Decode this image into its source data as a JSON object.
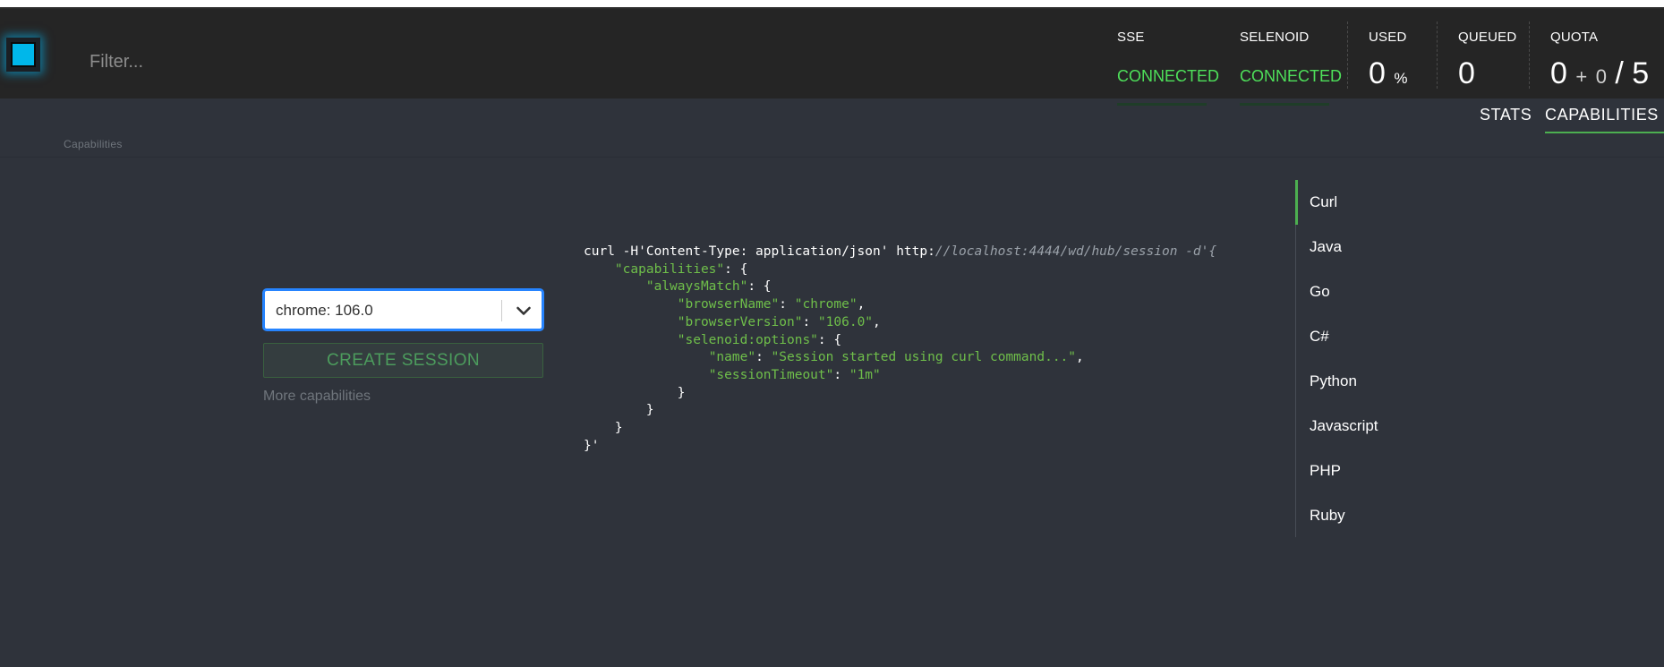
{
  "filter": {
    "placeholder": "Filter..."
  },
  "stats": {
    "sse": {
      "label": "SSE",
      "status": "CONNECTED"
    },
    "selenoid": {
      "label": "SELENOID",
      "status": "CONNECTED"
    },
    "used": {
      "label": "USED",
      "value": "0",
      "unit": "%"
    },
    "queued": {
      "label": "QUEUED",
      "value": "0"
    },
    "quota": {
      "label": "QUOTA",
      "current": "0",
      "plus": "+",
      "pending": "0",
      "separator": "/",
      "total": "5"
    }
  },
  "tabs": [
    {
      "label": "STATS",
      "active": false
    },
    {
      "label": "CAPABILITIES",
      "active": true
    }
  ],
  "breadcrumb": "Capabilities",
  "browser_select": {
    "value": "chrome: 106.0"
  },
  "create_button": {
    "label": "CREATE SESSION"
  },
  "more_capabilities": "More capabilities",
  "code": {
    "cmd": "curl -H'Content-Type: application/json' http:",
    "url": "//localhost:4444/wd/hub/session -d'{",
    "k_capabilities": "\"capabilities\"",
    "k_alwaysMatch": "\"alwaysMatch\"",
    "k_browserName": "\"browserName\"",
    "v_browserName": "\"chrome\"",
    "k_browserVersion": "\"browserVersion\"",
    "v_browserVersion": "\"106.0\"",
    "k_selenoid": "\"selenoid:options\"",
    "k_name": "\"name\"",
    "v_name": "\"Session started using curl command...\"",
    "k_timeout": "\"sessionTimeout\"",
    "v_timeout": "\"1m\"",
    "end": "}'"
  },
  "languages": [
    "Curl",
    "Java",
    "Go",
    "C#",
    "Python",
    "Javascript",
    "PHP",
    "Ruby"
  ],
  "active_language": "Curl",
  "colors": {
    "accent_green": "#4ee05a",
    "header_bg": "#252525",
    "page_bg": "#2f333b",
    "logo_blue": "#00b7ea",
    "select_focus": "#2684ff"
  }
}
